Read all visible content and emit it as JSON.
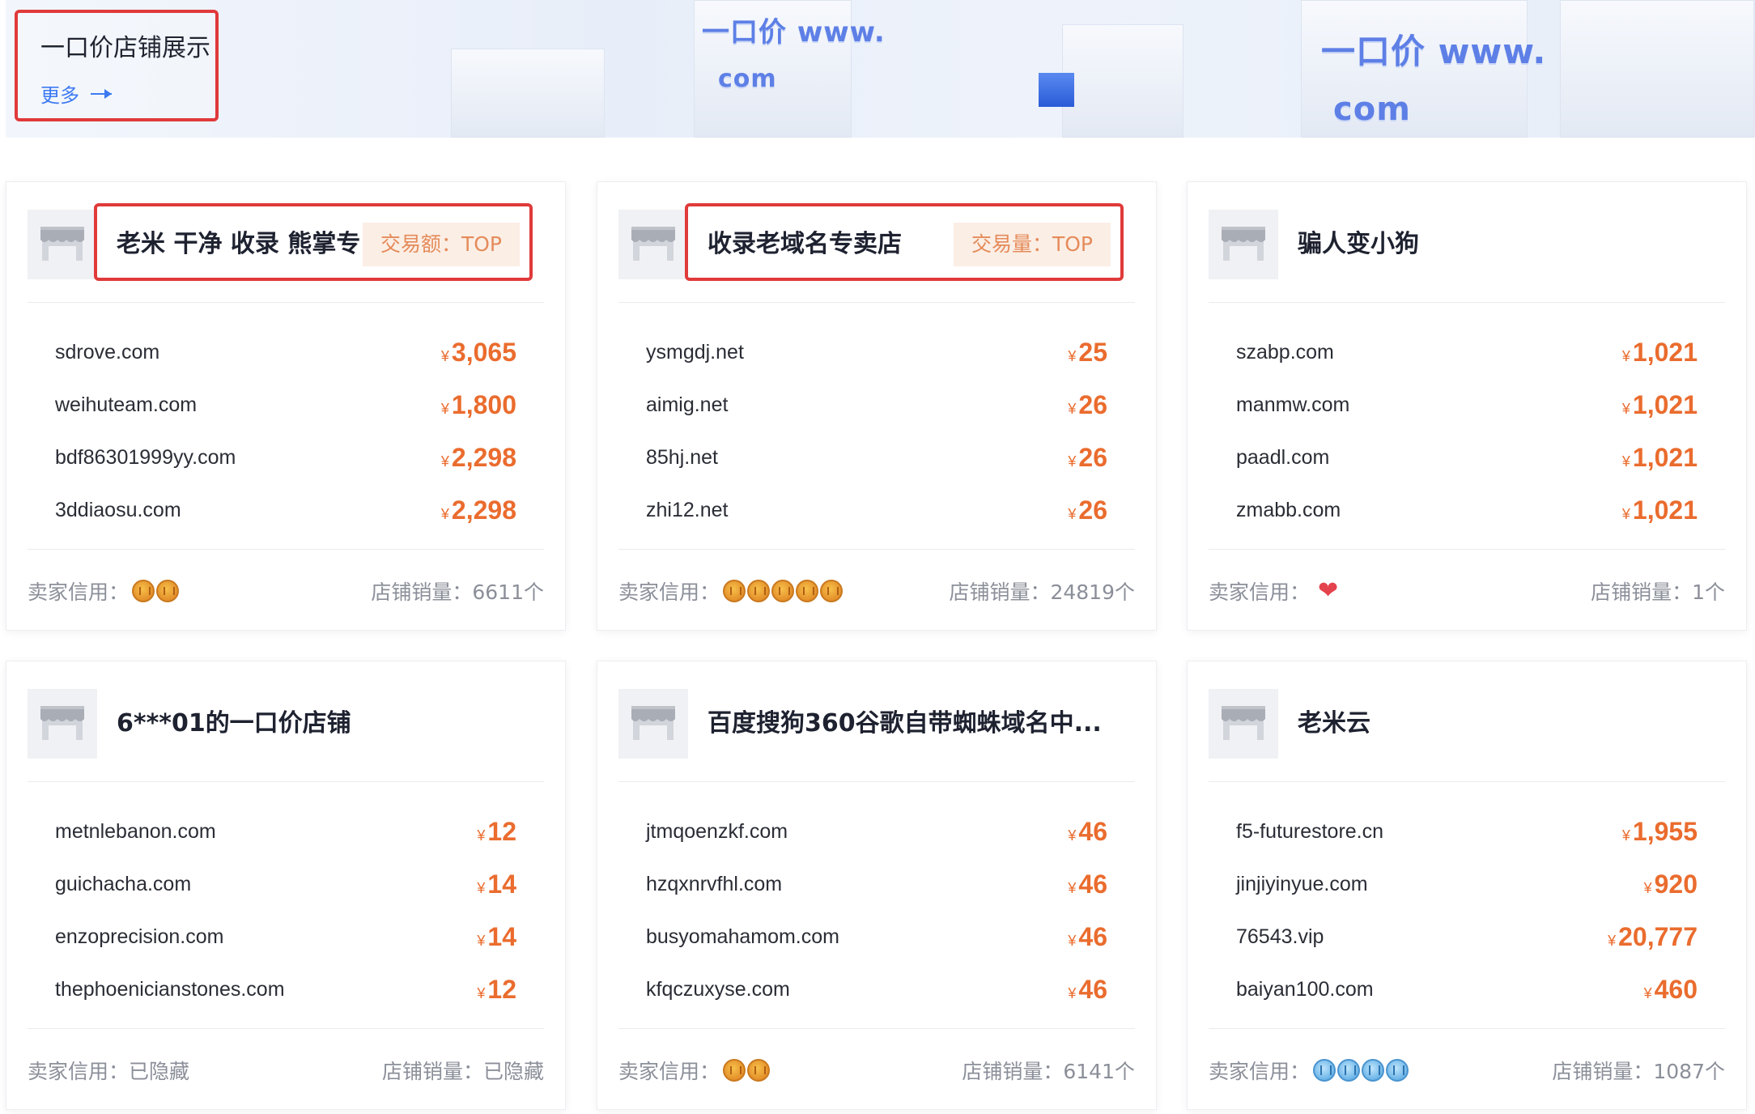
{
  "banner": {
    "title": "一口价店铺展示",
    "more_label": "更多",
    "logo_text_1": "一口价 www.",
    "logo_text_2": "com",
    "logo_text_3": "一口价 www.",
    "logo_text_4": "com",
    "highlight_color": "#e03a3a"
  },
  "labels": {
    "credit": "卖家信用：",
    "sales": "店铺销量："
  },
  "stores": [
    {
      "name": "老米 干净 收录 熊掌专...",
      "tag": "交易额：TOP",
      "items": [
        {
          "domain": "sdrove.com",
          "price": "3,065"
        },
        {
          "domain": "weihuteam.com",
          "price": "1,800"
        },
        {
          "domain": "bdf86301999yy.com",
          "price": "2,298"
        },
        {
          "domain": "3ddiaosu.com",
          "price": "2,298"
        }
      ],
      "credit_badge": "crown",
      "credit_count": 2,
      "credit_text": "",
      "sales": "6611个"
    },
    {
      "name": "收录老域名专卖店",
      "tag": "交易量：TOP",
      "items": [
        {
          "domain": "ysmgdj.net",
          "price": "25"
        },
        {
          "domain": "aimig.net",
          "price": "26"
        },
        {
          "domain": "85hj.net",
          "price": "26"
        },
        {
          "domain": "zhi12.net",
          "price": "26"
        }
      ],
      "credit_badge": "crown",
      "credit_count": 5,
      "credit_text": "",
      "sales": "24819个"
    },
    {
      "name": "骗人变小狗",
      "tag": "",
      "items": [
        {
          "domain": "szabp.com",
          "price": "1,021"
        },
        {
          "domain": "manmw.com",
          "price": "1,021"
        },
        {
          "domain": "paadl.com",
          "price": "1,021"
        },
        {
          "domain": "zmabb.com",
          "price": "1,021"
        }
      ],
      "credit_badge": "heart",
      "credit_count": 1,
      "credit_text": "",
      "sales": "1个"
    },
    {
      "name": "6***01的一口价店铺",
      "tag": "",
      "items": [
        {
          "domain": "metnlebanon.com",
          "price": "12"
        },
        {
          "domain": "guichacha.com",
          "price": "14"
        },
        {
          "domain": "enzoprecision.com",
          "price": "14"
        },
        {
          "domain": "thephoenicianstones.com",
          "price": "12"
        }
      ],
      "credit_badge": "none",
      "credit_count": 0,
      "credit_text": "已隐藏",
      "sales": "已隐藏"
    },
    {
      "name": "百度搜狗360谷歌自带蜘蛛域名中...",
      "tag": "",
      "items": [
        {
          "domain": "jtmqoenzkf.com",
          "price": "46"
        },
        {
          "domain": "hzqxnrvfhl.com",
          "price": "46"
        },
        {
          "domain": "busyomahamom.com",
          "price": "46"
        },
        {
          "domain": "kfqczuxyse.com",
          "price": "46"
        }
      ],
      "credit_badge": "crown",
      "credit_count": 2,
      "credit_text": "",
      "sales": "6141个"
    },
    {
      "name": "老米云",
      "tag": "",
      "items": [
        {
          "domain": "f5-futurestore.cn",
          "price": "1,955"
        },
        {
          "domain": "jinjiyinyue.com",
          "price": "920"
        },
        {
          "domain": "76543.vip",
          "price": "20,777"
        },
        {
          "domain": "baiyan100.com",
          "price": "460"
        }
      ],
      "credit_badge": "diamond",
      "credit_count": 4,
      "credit_text": "",
      "sales": "1087个"
    }
  ],
  "currency_symbol": "¥",
  "accent_price_color": "#ea6c2e"
}
